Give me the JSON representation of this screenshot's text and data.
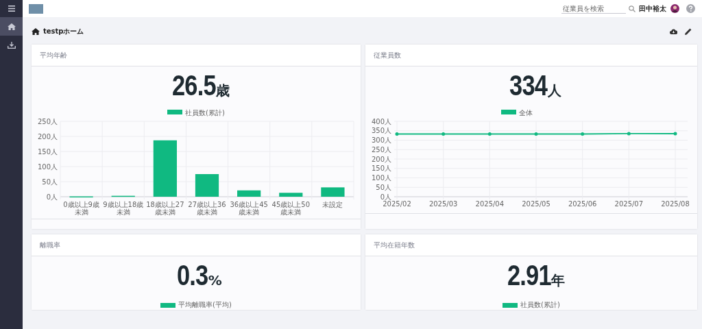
{
  "sidebar": {
    "items": [
      {
        "kind": "home",
        "selected": true
      },
      {
        "kind": "download",
        "selected": false
      }
    ]
  },
  "header": {
    "search": {
      "placeholder": "従業員を検索"
    },
    "user_name": "田中裕太"
  },
  "page": {
    "title": "testpホーム"
  },
  "cards": [
    {
      "title": "平均年齢",
      "value": "26.5",
      "unit": "歳",
      "chart_data": {
        "type": "bar",
        "categories": [
          "0歳以上9歳未満",
          "9歳以上18歳未満",
          "18歳以上27歳未満",
          "27歳以上36歳未満",
          "36歳以上45歳未満",
          "45歳以上50歳未満",
          "未設定"
        ],
        "series": [
          {
            "name": "社員数(累計)",
            "color": "#10b981",
            "values": [
              1,
              3,
              187,
              75,
              21,
              13,
              31
            ]
          }
        ],
        "grid": true,
        "ylim": [
          0,
          250
        ],
        "yticks": [
          {
            "value": 0,
            "label": "0人"
          },
          {
            "value": 50,
            "label": "50人"
          },
          {
            "value": 100,
            "label": "100人"
          },
          {
            "value": 150,
            "label": "150人"
          },
          {
            "value": 200,
            "label": "200人"
          },
          {
            "value": 250,
            "label": "250人"
          }
        ]
      }
    },
    {
      "title": "従業員数",
      "value": "334",
      "unit": "人",
      "chart_data": {
        "type": "line",
        "categories": [
          "2025/02",
          "2025/03",
          "2025/04",
          "2025/05",
          "2025/06",
          "2025/07",
          "2025/08"
        ],
        "series": [
          {
            "name": "全体",
            "color": "#10b981",
            "values": [
              333,
              333,
              333,
              333,
              333,
              335,
              335
            ]
          }
        ],
        "grid": true,
        "ylim": [
          0,
          400
        ],
        "yticks": [
          {
            "value": 0,
            "label": "0人"
          },
          {
            "value": 50,
            "label": "50人"
          },
          {
            "value": 100,
            "label": "100人"
          },
          {
            "value": 150,
            "label": "150人"
          },
          {
            "value": 200,
            "label": "200人"
          },
          {
            "value": 250,
            "label": "250人"
          },
          {
            "value": 300,
            "label": "300人"
          },
          {
            "value": 350,
            "label": "350人"
          },
          {
            "value": 400,
            "label": "400人"
          }
        ]
      }
    },
    {
      "title": "離職率",
      "value": "0.3",
      "unit": "%",
      "legend": {
        "label": "平均離職率(平均)",
        "color": "#10b981"
      }
    },
    {
      "title": "平均在籍年数",
      "value": "2.91",
      "unit": "年",
      "legend": {
        "label": "社員数(累計)",
        "color": "#10b981"
      }
    }
  ]
}
